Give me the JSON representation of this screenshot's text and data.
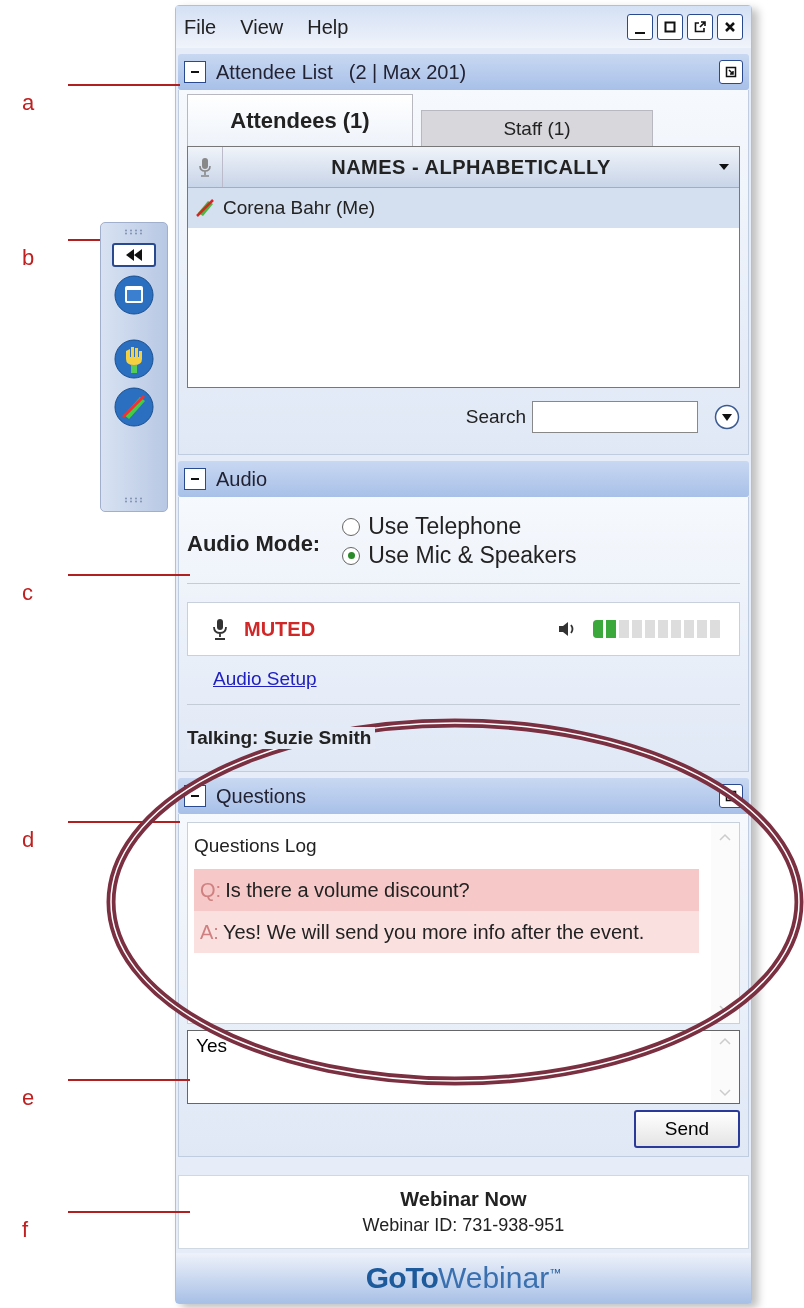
{
  "annotations": [
    {
      "label": "a"
    },
    {
      "label": "b"
    },
    {
      "label": "c"
    },
    {
      "label": "d"
    },
    {
      "label": "e"
    },
    {
      "label": "f"
    }
  ],
  "menu": [
    {
      "label": "File"
    },
    {
      "label": "View"
    },
    {
      "label": "Help"
    }
  ],
  "attendee_panel": {
    "title": "Attendee List",
    "count": "(2 | Max 201)",
    "expanded": true,
    "tabs": [
      {
        "label": "Attendees (1)",
        "selected": true
      },
      {
        "label": "Staff (1)",
        "selected": false
      }
    ],
    "column": "NAMES - ALPHABETICALLY",
    "rows": [
      {
        "name": "Corena Bahr (Me)",
        "selected": true,
        "muted": true
      }
    ],
    "search_label": "Search"
  },
  "audio": {
    "title": "Audio",
    "expanded": true,
    "mode_label": "Audio Mode:",
    "options": [
      {
        "label": "Use Telephone",
        "selected": false
      },
      {
        "label": "Use Mic & Speakers",
        "selected": true
      }
    ],
    "mic_status": "MUTED",
    "level": 0.2,
    "setup_link": "Audio Setup",
    "talking": "Talking: Suzie Smith"
  },
  "questions": {
    "title": "Questions",
    "expanded": true,
    "log_title": "Questions Log",
    "entries": [
      {
        "prefix": "Q:",
        "text": "Is there a volume discount?"
      },
      {
        "prefix": "A:",
        "text": "Yes! We will send you more info after the event."
      }
    ],
    "input_value": "Yes",
    "send": "Send"
  },
  "info": {
    "title": "Webinar Now",
    "id": "Webinar ID: 731-938-951"
  },
  "logo": {
    "bold": "GoTo",
    "light": "Webinar",
    "mark": "™"
  }
}
